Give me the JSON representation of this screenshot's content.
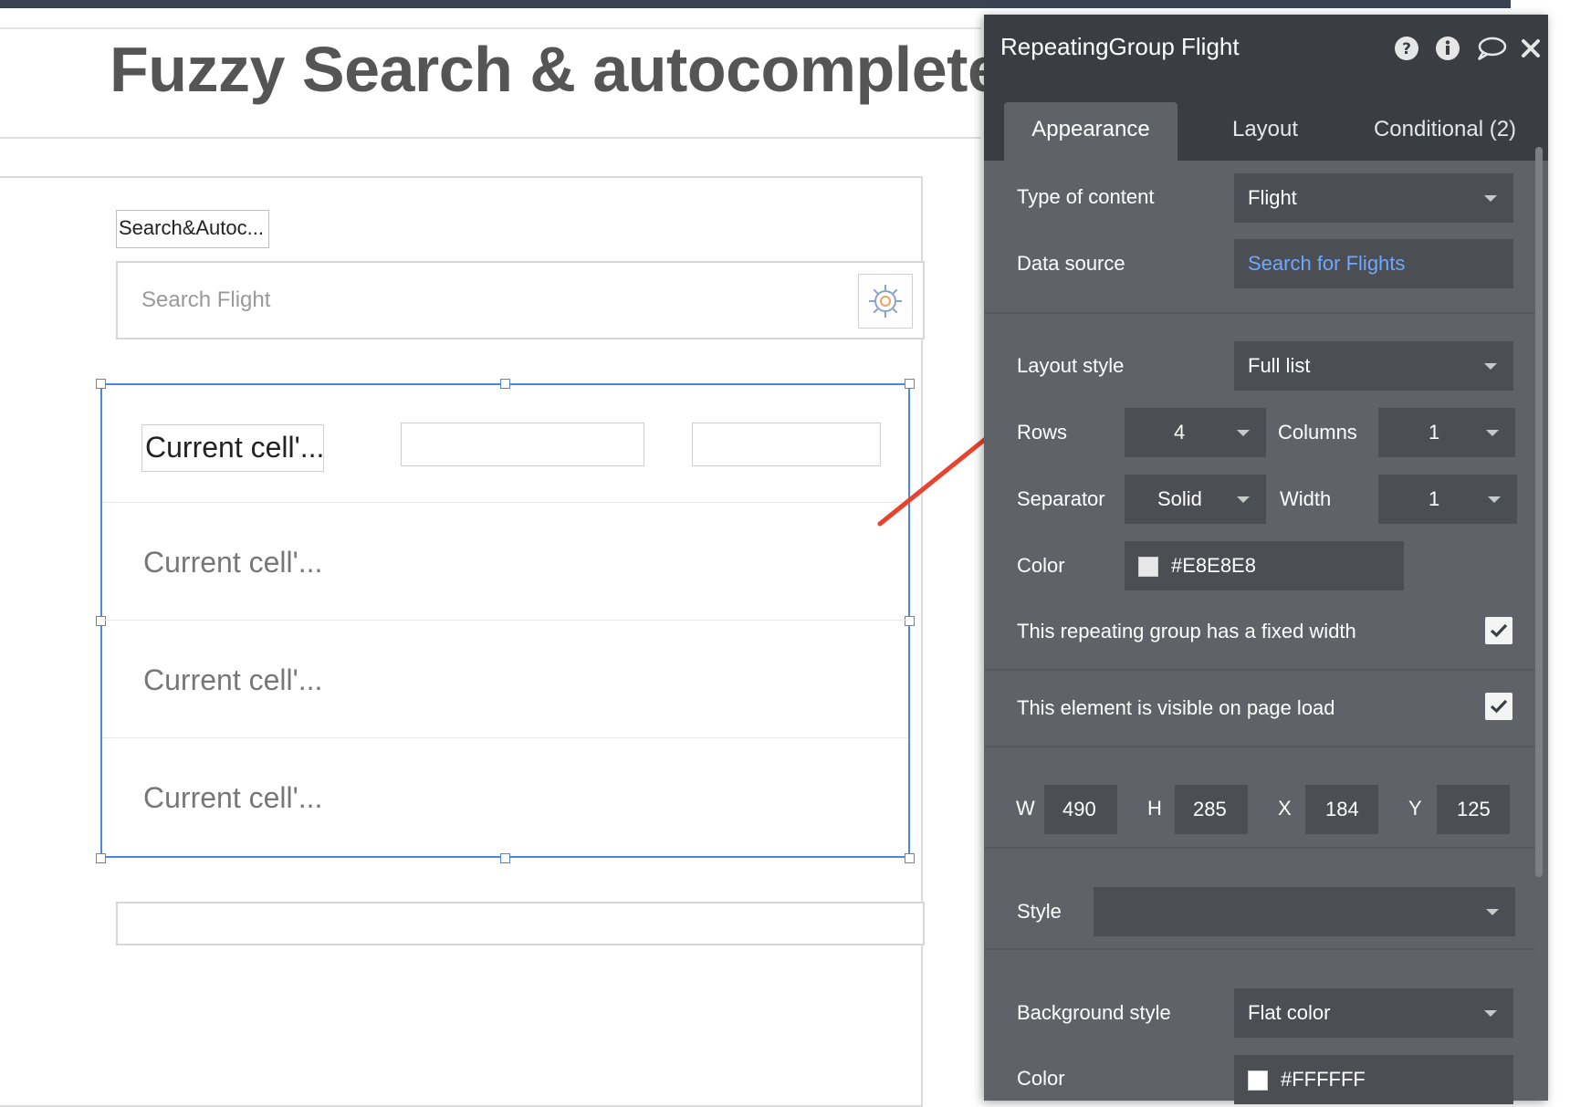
{
  "canvas": {
    "page_title": "Fuzzy Search & autocomplete",
    "search_label": "Search&Autoc...",
    "search_placeholder": "Search Flight",
    "cell_texts": [
      "Current cell'...",
      "Current cell'...",
      "Current cell'...",
      "Current cell'..."
    ]
  },
  "panel": {
    "title": "RepeatingGroup Flight",
    "header_icons": [
      "help-icon",
      "info-icon",
      "comment-icon",
      "close-icon"
    ],
    "tabs": [
      {
        "label": "Appearance",
        "active": true
      },
      {
        "label": "Layout",
        "active": false
      },
      {
        "label": "Conditional (2)",
        "active": false
      }
    ],
    "type_of_content": {
      "label": "Type of content",
      "value": "Flight"
    },
    "data_source": {
      "label": "Data source",
      "value": "Search for Flights"
    },
    "layout_style": {
      "label": "Layout style",
      "value": "Full list"
    },
    "rows": {
      "label": "Rows",
      "value": "4"
    },
    "columns": {
      "label": "Columns",
      "value": "1"
    },
    "separator": {
      "label": "Separator",
      "value": "Solid"
    },
    "separator_width": {
      "label": "Width",
      "value": "1"
    },
    "separator_color": {
      "label": "Color",
      "value": "#E8E8E8",
      "swatch": "#E8E8E8"
    },
    "fixed_width": {
      "label": "This repeating group has a fixed width",
      "checked": true
    },
    "visible_on_load": {
      "label": "This element is visible on page load",
      "checked": true
    },
    "dimensions": {
      "w_label": "W",
      "w": "490",
      "h_label": "H",
      "h": "285",
      "x_label": "X",
      "x": "184",
      "y_label": "Y",
      "y": "125"
    },
    "style": {
      "label": "Style",
      "value": ""
    },
    "background_style": {
      "label": "Background style",
      "value": "Flat color"
    },
    "background_color": {
      "label": "Color",
      "value": "#FFFFFF",
      "swatch": "#FFFFFF"
    }
  },
  "colors": {
    "selection": "#4a89dc",
    "arrow": "#e8432e",
    "panel_bg": "#5f6368",
    "panel_header": "#3a3d42",
    "link": "#6fa8ff"
  }
}
